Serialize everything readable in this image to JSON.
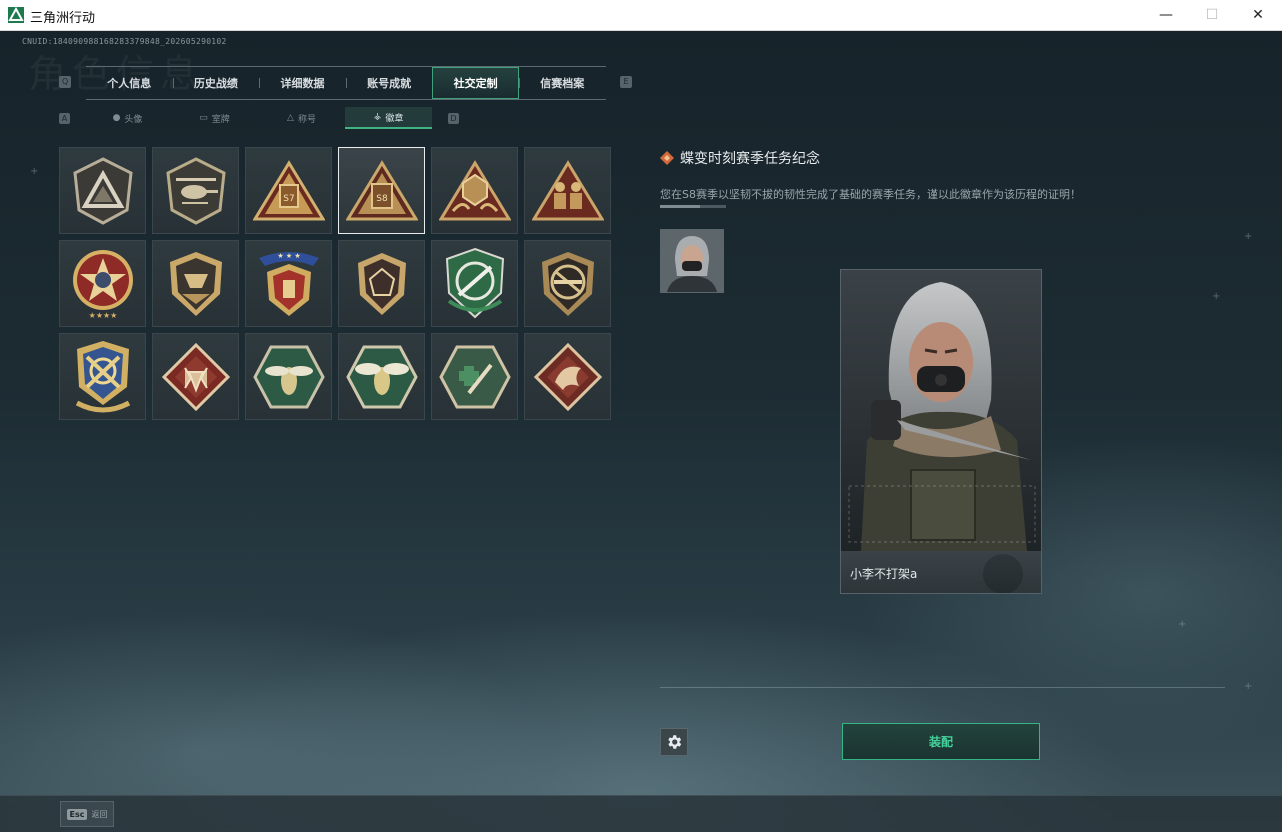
{
  "window": {
    "title": "三角洲行动"
  },
  "header": {
    "uid": "CNUID:184090988168283379848_202605290102",
    "ghost_title": "角色信息"
  },
  "main_tabs": {
    "left_key": "Q",
    "right_key": "E",
    "items": [
      {
        "label": "个人信息"
      },
      {
        "label": "历史战绩"
      },
      {
        "label": "详细数据"
      },
      {
        "label": "账号成就"
      },
      {
        "label": "社交定制",
        "active": true
      },
      {
        "label": "信赛档案"
      }
    ]
  },
  "sub_tabs": {
    "left_key": "A",
    "right_key": "D",
    "items": [
      {
        "label": "头像",
        "icon": "person-icon"
      },
      {
        "label": "室牌",
        "icon": "card-icon"
      },
      {
        "label": "称号",
        "icon": "triangle-icon"
      },
      {
        "label": "徽章",
        "icon": "wings-icon",
        "active": true
      }
    ]
  },
  "badges": {
    "selected_index": 3,
    "items": [
      {
        "icon": "delta-triangle-badge-icon"
      },
      {
        "icon": "helicopter-badge-icon"
      },
      {
        "icon": "s7-season-badge-icon",
        "text": "S7"
      },
      {
        "icon": "s8-season-badge-icon",
        "text": "S8"
      },
      {
        "icon": "dice-hands-badge-icon"
      },
      {
        "icon": "soldiers-badge-icon"
      },
      {
        "icon": "star-medal-badge-icon"
      },
      {
        "icon": "wing-shield-badge-icon"
      },
      {
        "icon": "laurel-shield-badge-icon"
      },
      {
        "icon": "gem-shield-badge-icon"
      },
      {
        "icon": "green-rifle-badge-icon"
      },
      {
        "icon": "rifle-ban-badge-icon"
      },
      {
        "icon": "crossed-rifles-badge-icon"
      },
      {
        "icon": "wolf-badge-icon"
      },
      {
        "icon": "hornet-badge-icon"
      },
      {
        "icon": "hornet-alt-badge-icon"
      },
      {
        "icon": "medic-badge-icon"
      },
      {
        "icon": "dragon-badge-icon"
      }
    ]
  },
  "detail": {
    "title": "蝶变时刻赛季任务纪念",
    "description": "您在S8赛季以坚韧不拔的韧性完成了基础的赛季任务，谨以此徽章作为该历程的证明！"
  },
  "card": {
    "player_name": "小李不打架a"
  },
  "actions": {
    "equip_label": "装配"
  },
  "footer": {
    "esc_key": "Esc",
    "esc_label": "返回"
  },
  "colors": {
    "accent": "#3fb384",
    "equip_text": "#45d19b",
    "badge_gold": "#c9a86a",
    "badge_red": "#8a2a22"
  }
}
